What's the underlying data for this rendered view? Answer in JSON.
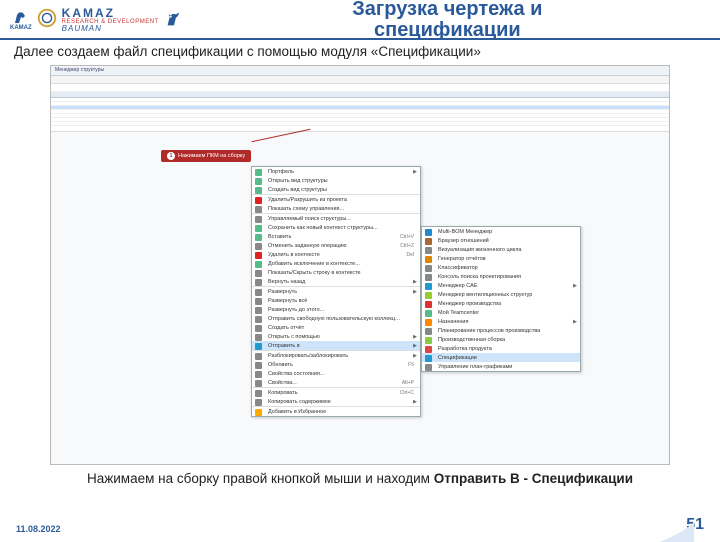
{
  "header": {
    "title_l1": "Загрузка чертежа и",
    "title_l2": "спецификации",
    "kamaz": "KAMAZ",
    "rd": "RESEARCH & DEVELOPMENT",
    "bauman": "BAUMAN"
  },
  "subtitle": "Далее создаем файл спецификации с помощью модуля «Спецификации»",
  "app": {
    "title": "Менеджер структуры",
    "callout": "Нажимаем ПКМ на сборку"
  },
  "ctx1": [
    {
      "ic": "#5b8",
      "label": "Портфель",
      "arrow": true
    },
    {
      "ic": "#5b8",
      "label": "Открыть вид структуры"
    },
    {
      "ic": "#5b8",
      "label": "Создать вид структуры"
    },
    {
      "ic": "#d22",
      "label": "Удалить/Разрушить из проекта",
      "sep": true
    },
    {
      "ic": "#888",
      "label": "Показать схему управления..."
    },
    {
      "ic": "#888",
      "label": "Управляемый поиск структуры...",
      "sep": true
    },
    {
      "ic": "#5b8",
      "label": "Сохранить как новый контекст структуры..."
    },
    {
      "ic": "#5b8",
      "label": "Вставить",
      "shortcut": "Ctrl+V"
    },
    {
      "ic": "#888",
      "label": "Отменить заданную операцию",
      "shortcut": "Ctrl+Z"
    },
    {
      "ic": "#d22",
      "label": "Удалить в контексте",
      "shortcut": "Del"
    },
    {
      "ic": "#5b8",
      "label": "Добавить исключение в контексте..."
    },
    {
      "ic": "#888",
      "label": "Показать/Скрыть строку в контексте"
    },
    {
      "ic": "#888",
      "label": "Вернуть назад",
      "arrow": true
    },
    {
      "ic": "#888",
      "label": "Развернуть",
      "arrow": true,
      "sep": true
    },
    {
      "ic": "#888",
      "label": "Развернуть всё"
    },
    {
      "ic": "#888",
      "label": "Развернуть до этого..."
    },
    {
      "ic": "#888",
      "label": "Отправить свободную пользовательскую коллекцию..."
    },
    {
      "ic": "#888",
      "label": "Создать отчёт"
    },
    {
      "ic": "#888",
      "label": "Открыть с помощью",
      "arrow": true
    },
    {
      "ic": "#29c",
      "label": "Отправить в",
      "arrow": true,
      "hl": true
    },
    {
      "ic": "#888",
      "label": "Разблокировать/заблокировать",
      "arrow": true,
      "sep": true
    },
    {
      "ic": "#888",
      "label": "Обновить",
      "shortcut": "F5"
    },
    {
      "ic": "#888",
      "label": "Свойства состояния..."
    },
    {
      "ic": "#888",
      "label": "Свойства...",
      "shortcut": "Alt+P"
    },
    {
      "ic": "#888",
      "label": "Копировать",
      "shortcut": "Ctrl+C",
      "sep": true
    },
    {
      "ic": "#888",
      "label": "Копировать содержимое",
      "arrow": true
    },
    {
      "ic": "#fa0",
      "label": "Добавить в Избранное",
      "sep": true
    }
  ],
  "ctx2": [
    {
      "ic": "#28c",
      "label": "Multi-BOM Менеджер"
    },
    {
      "ic": "#a63",
      "label": "Браузер отношений"
    },
    {
      "ic": "#888",
      "label": "Визуализация жизненного цикла"
    },
    {
      "ic": "#d80",
      "label": "Генератор отчётов"
    },
    {
      "ic": "#888",
      "label": "Классификатор"
    },
    {
      "ic": "#888",
      "label": "Консоль поиска проектирования"
    },
    {
      "ic": "#29c",
      "label": "Менеджер CAE",
      "arrow": true
    },
    {
      "ic": "#9c3",
      "label": "Менеджер вентиляционных структур"
    },
    {
      "ic": "#d33",
      "label": "Менеджер производства"
    },
    {
      "ic": "#5b8",
      "label": "Мой Teamcenter"
    },
    {
      "ic": "#f80",
      "label": "Назначения",
      "arrow": true
    },
    {
      "ic": "#888",
      "label": "Планирование процессов производства"
    },
    {
      "ic": "#8c4",
      "label": "Производственная сборка"
    },
    {
      "ic": "#d44",
      "label": "Разработка продукта"
    },
    {
      "ic": "#29c",
      "label": "Спецификации",
      "hl": true
    },
    {
      "ic": "#888",
      "label": "Управление план-графиками"
    }
  ],
  "caption_prefix": "Нажимаем на сборку правой кнопкой мыши и находим ",
  "caption_bold": "Отправить В - Спецификации",
  "footer": {
    "date": "11.08.2022",
    "page": "51"
  }
}
